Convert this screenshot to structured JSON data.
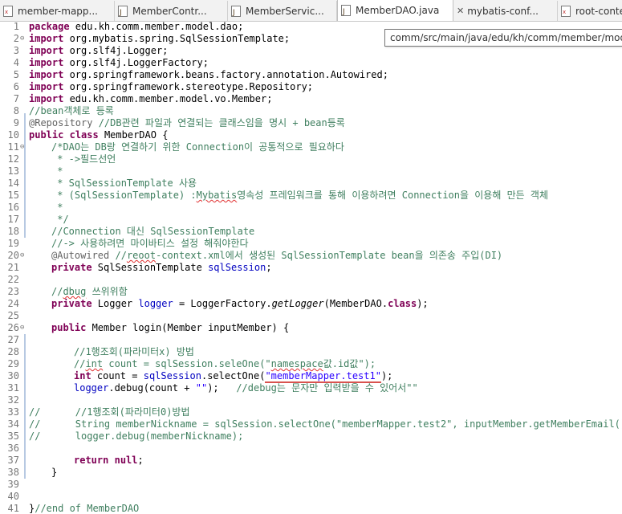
{
  "tabs": [
    {
      "label": "member-mapp...",
      "icon": "xml-file-icon",
      "active": false
    },
    {
      "label": "MemberContr...",
      "icon": "java-file-icon",
      "active": false
    },
    {
      "label": "MemberServic...",
      "icon": "java-file-icon",
      "active": false
    },
    {
      "label": "MemberDAO.java",
      "icon": "java-file-icon",
      "active": true
    },
    {
      "label": "mybatis-conf...",
      "icon": "xml-file-icon",
      "active": false
    },
    {
      "label": "root-context...",
      "icon": "xml-file-icon",
      "active": false
    }
  ],
  "tooltip": "comm/src/main/java/edu/kh/comm/member/model/",
  "line_numbers": [
    "1",
    "2",
    "3",
    "4",
    "5",
    "6",
    "7",
    "8",
    "9",
    "10",
    "11",
    "12",
    "13",
    "14",
    "15",
    "16",
    "17",
    "18",
    "19",
    "20",
    "21",
    "22",
    "23",
    "24",
    "25",
    "26",
    "27",
    "28",
    "29",
    "30",
    "31",
    "32",
    "33",
    "34",
    "35",
    "36",
    "37",
    "38",
    "39",
    "40",
    "41"
  ],
  "code": {
    "l1_kw": "package",
    "l1_rest": " edu.kh.comm.member.model.dao;",
    "l2_kw": "import",
    "l2_rest": " org.mybatis.spring.SqlSessionTemplate;",
    "l3_kw": "import",
    "l3_rest": " org.slf4j.Logger;",
    "l4_kw": "import",
    "l4_rest": " org.slf4j.LoggerFactory;",
    "l5_kw": "import",
    "l5_rest": " org.springframework.beans.factory.annotation.Autowired;",
    "l6_kw": "import",
    "l6_rest": " org.springframework.stereotype.Repository;",
    "l7_kw": "import",
    "l7_rest": " edu.kh.comm.member.model.vo.Member;",
    "l8": "//bean객체로 등록",
    "l9_an": "@Repository",
    "l9_cm": " //DB관련 파일과 연결되는 클래스임을 명시 + bean등록",
    "l10_kw1": "public",
    "l10_kw2": "class",
    "l10_rest": " MemberDAO {",
    "l11": "/*DAO는 DB랑 연결하기 위한 Connection이 공통적으로 필요하다",
    "l12": " * ->필드선언",
    "l13": " *",
    "l14": " * SqlSessionTemplate 사용",
    "l15_a": " * (SqlSessionTemplate) :",
    "l15_b": "Mybatis",
    "l15_c": "영속성 프레임워크를 통해 이용하려면 Connection을 이용해 만든 객체",
    "l16": " *",
    "l17": " */",
    "l18": "//Connection 대신 SqlSessionTemplate",
    "l19": "//-> 사용하려면 마이바티스 설정 해줘야한다",
    "l20_an": "@Autowired",
    "l20_a": " //",
    "l20_b": "reoot",
    "l20_c": "-context.xml에서 생성된 SqlSessionTemplate bean을 의존송 주입(DI)",
    "l21_kw": "private",
    "l21_type": " SqlSessionTemplate ",
    "l21_fld": "sqlSession",
    "l21_end": ";",
    "l23_a": "//",
    "l23_b": "dbug",
    "l23_c": " 쓰위위함",
    "l24_kw": "private",
    "l24_type": " Logger ",
    "l24_fld": "logger",
    "l24_mid": " = LoggerFactory.",
    "l24_it": "getLogger",
    "l24_end": "(MemberDAO.",
    "l24_kw2": "class",
    "l24_end2": ");",
    "l26_kw": "public",
    "l26_rest": " Member login(Member inputMember) {",
    "l28": "//1행조회(파라미터x) 방법",
    "l29_a": "//",
    "l29_b": "int",
    "l29_c": " count = sqlSession.seleOne(\"",
    "l29_d": "namespace",
    "l29_e": "값.id값\");",
    "l30_kw": "int",
    "l30_a": " count = ",
    "l30_fld": "sqlSession",
    "l30_b": ".selectOne(",
    "l30_str": "\"memberMapper.test1\"",
    "l30_end": ");",
    "l31_fld": "logger",
    "l31_a": ".debug(count + ",
    "l31_str": "\"\"",
    "l31_b": ");   ",
    "l31_cm": "//debug는 문자만 입력받을 수 있어서\"\"",
    "l32": "//      //1행조회(파라미터0)방법",
    "l33": "//      String memberNickname = sqlSession.selectOne(\"memberMapper.test2\", inputMember.getMemberEmail());",
    "l34": "//      logger.debug(memberNickname);",
    "l36_kw": "return",
    "l36_kw2": "null",
    "l36_end": ";",
    "l37": "}",
    "l40_a": "}",
    "l40_cm": "//end of MemberDAO"
  },
  "colors": {
    "keyword": "#7f0055",
    "comment": "#3f7f5f",
    "javadoc": "#3f5fbf",
    "annotation": "#646464",
    "string": "#2a00ff",
    "field": "#0000c0"
  }
}
